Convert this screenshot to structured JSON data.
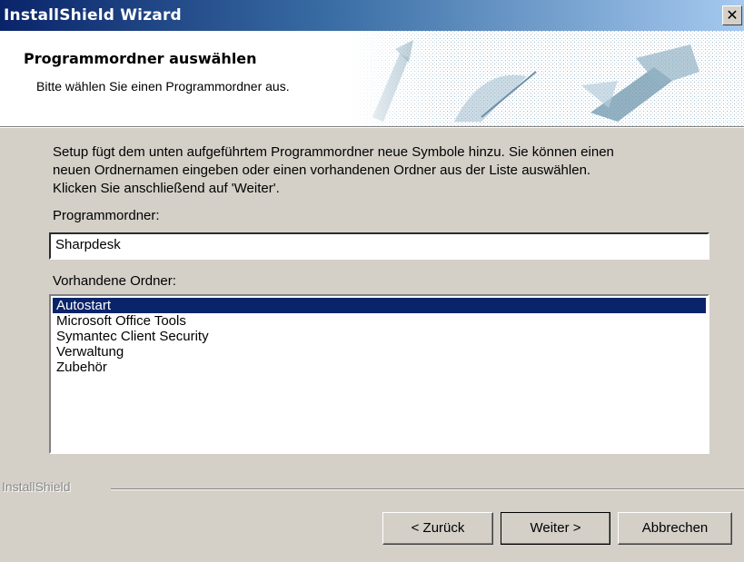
{
  "window": {
    "title": "InstallShield Wizard",
    "close_glyph": "✕"
  },
  "header": {
    "title": "Programmordner auswählen",
    "subtitle": "Bitte wählen Sie einen Programmordner aus."
  },
  "main": {
    "description_lines": [
      "Setup fügt dem unten aufgeführtem Programmordner neue Symbole hinzu. Sie können einen",
      "neuen Ordnernamen eingeben oder einen vorhandenen Ordner aus der Liste auswählen.",
      "Klicken Sie anschließend auf 'Weiter'."
    ],
    "folder_label": "Programmordner:",
    "folder_value": "Sharpdesk",
    "existing_label": "Vorhandene Ordner:",
    "existing_folders": [
      "Autostart",
      "Microsoft Office Tools",
      "Symantec Client Security",
      "Verwaltung",
      "Zubehör"
    ],
    "selected_index": 0
  },
  "footer": {
    "brand": "InstallShield",
    "back_label": "< Zurück",
    "next_label": "Weiter >",
    "cancel_label": "Abbrechen"
  }
}
